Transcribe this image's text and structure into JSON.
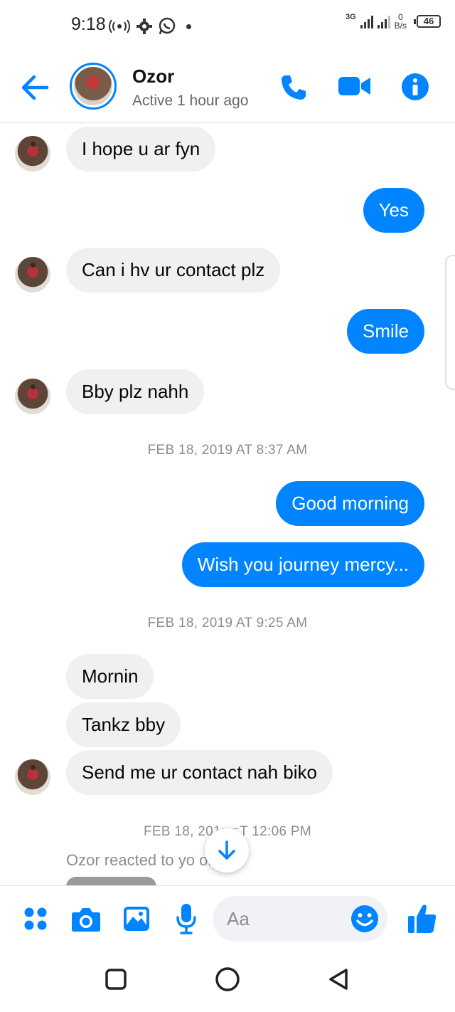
{
  "status_bar": {
    "time": "9:18",
    "network_type": "3G",
    "speed_value": "0",
    "speed_unit": "B/s",
    "battery": "46"
  },
  "header": {
    "contact_name": "Ozor",
    "status": "Active 1 hour ago"
  },
  "messages": [
    {
      "dir": "in",
      "text": "I hope u ar fyn"
    },
    {
      "dir": "out",
      "text": "Yes"
    },
    {
      "dir": "in",
      "text": "Can i hv ur contact plz"
    },
    {
      "dir": "out",
      "text": "Smile"
    },
    {
      "dir": "in",
      "text": "Bby plz nahh"
    },
    {
      "dir": "timestamp",
      "text": "FEB 18, 2019 AT 8:37 AM"
    },
    {
      "dir": "out",
      "text": "Good morning"
    },
    {
      "dir": "out",
      "text": "Wish you journey mercy..."
    },
    {
      "dir": "timestamp",
      "text": "FEB 18, 2019 AT 9:25 AM"
    },
    {
      "dir": "in",
      "text": "Mornin"
    },
    {
      "dir": "in",
      "text": "Tankz bby"
    },
    {
      "dir": "in",
      "text": "Send me ur contact nah biko"
    },
    {
      "dir": "timestamp",
      "text": "FEB 18, 201⁻ ⁻T 12:06 PM"
    },
    {
      "dir": "reaction",
      "text": "Ozor reacted to yo   ory"
    }
  ],
  "composer": {
    "placeholder": "Aa"
  },
  "colors": {
    "accent": "#0084ff",
    "incoming_bubble": "#f0f0f0",
    "timestamp": "#8a8d91"
  },
  "icons": [
    "back-arrow-icon",
    "phone-icon",
    "video-camera-icon",
    "info-icon",
    "menu-dots-icon",
    "camera-icon",
    "gallery-icon",
    "microphone-icon",
    "emoji-icon",
    "thumbs-up-icon",
    "arrow-down-icon"
  ]
}
